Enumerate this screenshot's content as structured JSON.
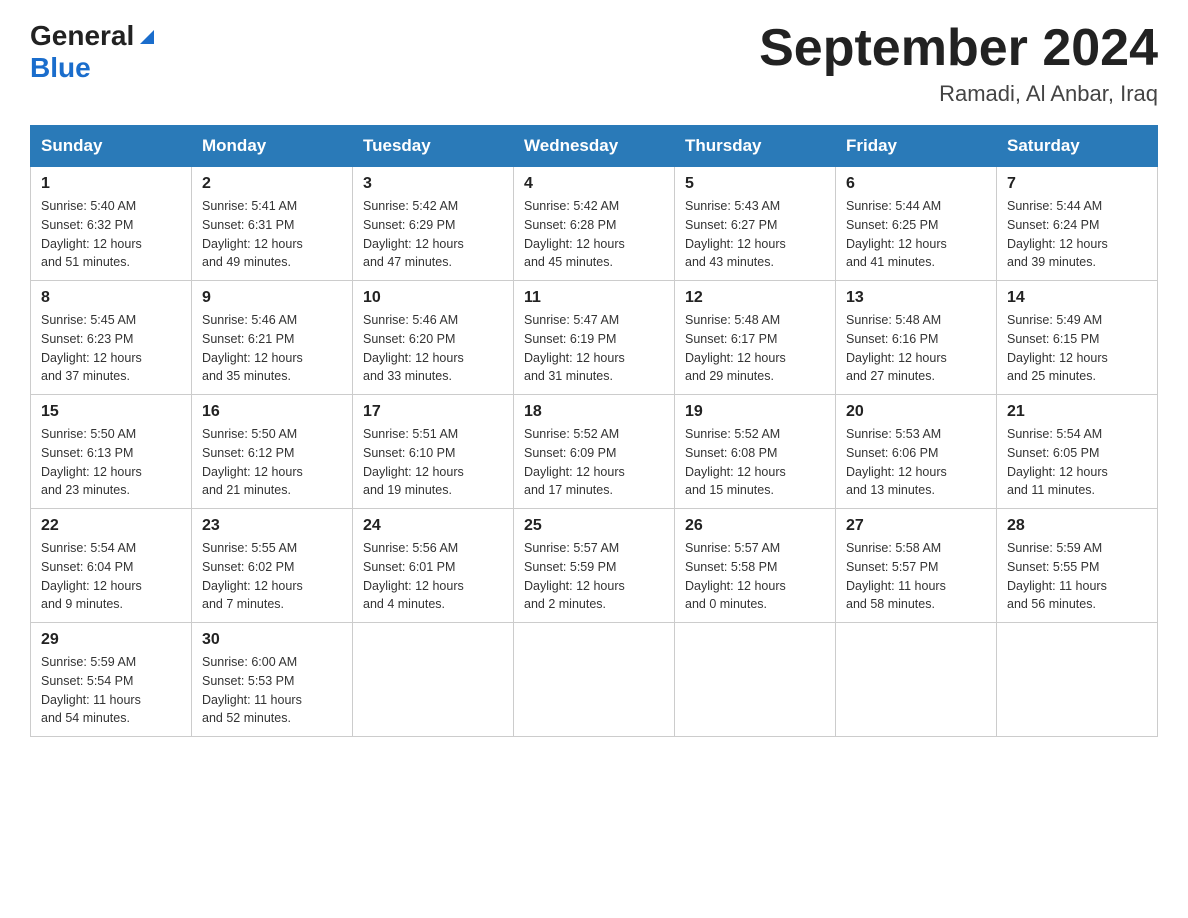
{
  "header": {
    "logo_general": "General",
    "logo_blue": "Blue",
    "month_title": "September 2024",
    "location": "Ramadi, Al Anbar, Iraq"
  },
  "days_of_week": [
    "Sunday",
    "Monday",
    "Tuesday",
    "Wednesday",
    "Thursday",
    "Friday",
    "Saturday"
  ],
  "weeks": [
    [
      {
        "day": "1",
        "sunrise": "5:40 AM",
        "sunset": "6:32 PM",
        "daylight": "12 hours and 51 minutes."
      },
      {
        "day": "2",
        "sunrise": "5:41 AM",
        "sunset": "6:31 PM",
        "daylight": "12 hours and 49 minutes."
      },
      {
        "day": "3",
        "sunrise": "5:42 AM",
        "sunset": "6:29 PM",
        "daylight": "12 hours and 47 minutes."
      },
      {
        "day": "4",
        "sunrise": "5:42 AM",
        "sunset": "6:28 PM",
        "daylight": "12 hours and 45 minutes."
      },
      {
        "day": "5",
        "sunrise": "5:43 AM",
        "sunset": "6:27 PM",
        "daylight": "12 hours and 43 minutes."
      },
      {
        "day": "6",
        "sunrise": "5:44 AM",
        "sunset": "6:25 PM",
        "daylight": "12 hours and 41 minutes."
      },
      {
        "day": "7",
        "sunrise": "5:44 AM",
        "sunset": "6:24 PM",
        "daylight": "12 hours and 39 minutes."
      }
    ],
    [
      {
        "day": "8",
        "sunrise": "5:45 AM",
        "sunset": "6:23 PM",
        "daylight": "12 hours and 37 minutes."
      },
      {
        "day": "9",
        "sunrise": "5:46 AM",
        "sunset": "6:21 PM",
        "daylight": "12 hours and 35 minutes."
      },
      {
        "day": "10",
        "sunrise": "5:46 AM",
        "sunset": "6:20 PM",
        "daylight": "12 hours and 33 minutes."
      },
      {
        "day": "11",
        "sunrise": "5:47 AM",
        "sunset": "6:19 PM",
        "daylight": "12 hours and 31 minutes."
      },
      {
        "day": "12",
        "sunrise": "5:48 AM",
        "sunset": "6:17 PM",
        "daylight": "12 hours and 29 minutes."
      },
      {
        "day": "13",
        "sunrise": "5:48 AM",
        "sunset": "6:16 PM",
        "daylight": "12 hours and 27 minutes."
      },
      {
        "day": "14",
        "sunrise": "5:49 AM",
        "sunset": "6:15 PM",
        "daylight": "12 hours and 25 minutes."
      }
    ],
    [
      {
        "day": "15",
        "sunrise": "5:50 AM",
        "sunset": "6:13 PM",
        "daylight": "12 hours and 23 minutes."
      },
      {
        "day": "16",
        "sunrise": "5:50 AM",
        "sunset": "6:12 PM",
        "daylight": "12 hours and 21 minutes."
      },
      {
        "day": "17",
        "sunrise": "5:51 AM",
        "sunset": "6:10 PM",
        "daylight": "12 hours and 19 minutes."
      },
      {
        "day": "18",
        "sunrise": "5:52 AM",
        "sunset": "6:09 PM",
        "daylight": "12 hours and 17 minutes."
      },
      {
        "day": "19",
        "sunrise": "5:52 AM",
        "sunset": "6:08 PM",
        "daylight": "12 hours and 15 minutes."
      },
      {
        "day": "20",
        "sunrise": "5:53 AM",
        "sunset": "6:06 PM",
        "daylight": "12 hours and 13 minutes."
      },
      {
        "day": "21",
        "sunrise": "5:54 AM",
        "sunset": "6:05 PM",
        "daylight": "12 hours and 11 minutes."
      }
    ],
    [
      {
        "day": "22",
        "sunrise": "5:54 AM",
        "sunset": "6:04 PM",
        "daylight": "12 hours and 9 minutes."
      },
      {
        "day": "23",
        "sunrise": "5:55 AM",
        "sunset": "6:02 PM",
        "daylight": "12 hours and 7 minutes."
      },
      {
        "day": "24",
        "sunrise": "5:56 AM",
        "sunset": "6:01 PM",
        "daylight": "12 hours and 4 minutes."
      },
      {
        "day": "25",
        "sunrise": "5:57 AM",
        "sunset": "5:59 PM",
        "daylight": "12 hours and 2 minutes."
      },
      {
        "day": "26",
        "sunrise": "5:57 AM",
        "sunset": "5:58 PM",
        "daylight": "12 hours and 0 minutes."
      },
      {
        "day": "27",
        "sunrise": "5:58 AM",
        "sunset": "5:57 PM",
        "daylight": "11 hours and 58 minutes."
      },
      {
        "day": "28",
        "sunrise": "5:59 AM",
        "sunset": "5:55 PM",
        "daylight": "11 hours and 56 minutes."
      }
    ],
    [
      {
        "day": "29",
        "sunrise": "5:59 AM",
        "sunset": "5:54 PM",
        "daylight": "11 hours and 54 minutes."
      },
      {
        "day": "30",
        "sunrise": "6:00 AM",
        "sunset": "5:53 PM",
        "daylight": "11 hours and 52 minutes."
      },
      null,
      null,
      null,
      null,
      null
    ]
  ],
  "labels": {
    "sunrise_prefix": "Sunrise: ",
    "sunset_prefix": "Sunset: ",
    "daylight_prefix": "Daylight: "
  }
}
